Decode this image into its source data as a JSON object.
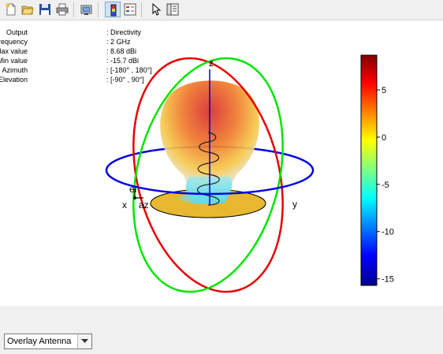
{
  "toolbar": {
    "buttons": [
      {
        "name": "new-figure-icon"
      },
      {
        "name": "open-file-icon"
      },
      {
        "name": "save-icon"
      },
      {
        "name": "print-icon"
      },
      {
        "name": "copy-figure-icon"
      },
      {
        "name": "colorbar-icon"
      },
      {
        "name": "legend-icon"
      },
      {
        "name": "pointer-icon"
      },
      {
        "name": "property-inspector-icon"
      }
    ]
  },
  "info": [
    {
      "key": "Output",
      "value": ": Directivity"
    },
    {
      "key": "Frequency",
      "value": ": 2 GHz"
    },
    {
      "key": "Max value",
      "value": ": 8.68 dBi"
    },
    {
      "key": "Min value",
      "value": ": -15.7 dBi"
    },
    {
      "key": "Azimuth",
      "value": ": [-180° , 180°]"
    },
    {
      "key": "Elevation",
      "value": ": [-90° , 90°]"
    }
  ],
  "axes": {
    "z": "z",
    "x": "x",
    "y": "y",
    "el": "el",
    "az": "az"
  },
  "colors": {
    "azimuth_ring": "#0000e6",
    "elevation_ring_green": "#00e600",
    "elevation_ring_red": "#e60000",
    "ground_plane": "#e8b830"
  },
  "colorbar": {
    "ticks": [
      {
        "label": "5",
        "value": 5
      },
      {
        "label": "0",
        "value": 0
      },
      {
        "label": "-5",
        "value": -5
      },
      {
        "label": "-10",
        "value": -10
      },
      {
        "label": "-15",
        "value": -15
      }
    ],
    "min": -15.7,
    "max": 8.68
  },
  "dropdown": {
    "selected": "Overlay Antenna"
  }
}
